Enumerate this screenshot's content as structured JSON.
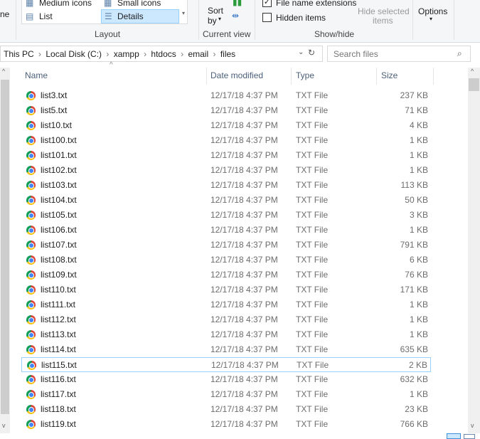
{
  "ribbon": {
    "left_partial": "ne",
    "layout": {
      "medium_icons": "Medium icons",
      "small_icons": "Small icons",
      "list": "List",
      "details": "Details",
      "label": "Layout"
    },
    "current_view": {
      "sort_by": "Sort",
      "sort_by2": "by",
      "label": "Current view"
    },
    "show_hide": {
      "file_name_extensions": "File name extensions",
      "file_name_extensions_checked": true,
      "hidden_items": "Hidden items",
      "hidden_items_checked": false,
      "hide_selected": "Hide selected",
      "hide_selected2": "items",
      "label": "Show/hide"
    },
    "options": "Options"
  },
  "address": {
    "crumbs": [
      "This PC",
      "Local Disk (C:)",
      "xampp",
      "htdocs",
      "email",
      "files"
    ]
  },
  "search": {
    "placeholder": "Search files"
  },
  "columns": {
    "name": "Name",
    "date": "Date modified",
    "type": "Type",
    "size": "Size"
  },
  "files": [
    {
      "name": "list3.txt",
      "date": "12/17/18 4:37 PM",
      "type": "TXT File",
      "size": "237 KB"
    },
    {
      "name": "list5.txt",
      "date": "12/17/18 4:37 PM",
      "type": "TXT File",
      "size": "71 KB"
    },
    {
      "name": "list10.txt",
      "date": "12/17/18 4:37 PM",
      "type": "TXT File",
      "size": "4 KB"
    },
    {
      "name": "list100.txt",
      "date": "12/17/18 4:37 PM",
      "type": "TXT File",
      "size": "1 KB"
    },
    {
      "name": "list101.txt",
      "date": "12/17/18 4:37 PM",
      "type": "TXT File",
      "size": "1 KB"
    },
    {
      "name": "list102.txt",
      "date": "12/17/18 4:37 PM",
      "type": "TXT File",
      "size": "1 KB"
    },
    {
      "name": "list103.txt",
      "date": "12/17/18 4:37 PM",
      "type": "TXT File",
      "size": "113 KB"
    },
    {
      "name": "list104.txt",
      "date": "12/17/18 4:37 PM",
      "type": "TXT File",
      "size": "50 KB"
    },
    {
      "name": "list105.txt",
      "date": "12/17/18 4:37 PM",
      "type": "TXT File",
      "size": "3 KB"
    },
    {
      "name": "list106.txt",
      "date": "12/17/18 4:37 PM",
      "type": "TXT File",
      "size": "1 KB"
    },
    {
      "name": "list107.txt",
      "date": "12/17/18 4:37 PM",
      "type": "TXT File",
      "size": "791 KB"
    },
    {
      "name": "list108.txt",
      "date": "12/17/18 4:37 PM",
      "type": "TXT File",
      "size": "6 KB"
    },
    {
      "name": "list109.txt",
      "date": "12/17/18 4:37 PM",
      "type": "TXT File",
      "size": "76 KB"
    },
    {
      "name": "list110.txt",
      "date": "12/17/18 4:37 PM",
      "type": "TXT File",
      "size": "171 KB"
    },
    {
      "name": "list111.txt",
      "date": "12/17/18 4:37 PM",
      "type": "TXT File",
      "size": "1 KB"
    },
    {
      "name": "list112.txt",
      "date": "12/17/18 4:37 PM",
      "type": "TXT File",
      "size": "1 KB"
    },
    {
      "name": "list113.txt",
      "date": "12/17/18 4:37 PM",
      "type": "TXT File",
      "size": "1 KB"
    },
    {
      "name": "list114.txt",
      "date": "12/17/18 4:37 PM",
      "type": "TXT File",
      "size": "635 KB"
    },
    {
      "name": "list115.txt",
      "date": "12/17/18 4:37 PM",
      "type": "TXT File",
      "size": "2 KB",
      "focused": true
    },
    {
      "name": "list116.txt",
      "date": "12/17/18 4:37 PM",
      "type": "TXT File",
      "size": "632 KB"
    },
    {
      "name": "list117.txt",
      "date": "12/17/18 4:37 PM",
      "type": "TXT File",
      "size": "1 KB"
    },
    {
      "name": "list118.txt",
      "date": "12/17/18 4:37 PM",
      "type": "TXT File",
      "size": "23 KB"
    },
    {
      "name": "list119.txt",
      "date": "12/17/18 4:37 PM",
      "type": "TXT File",
      "size": "766 KB"
    }
  ]
}
